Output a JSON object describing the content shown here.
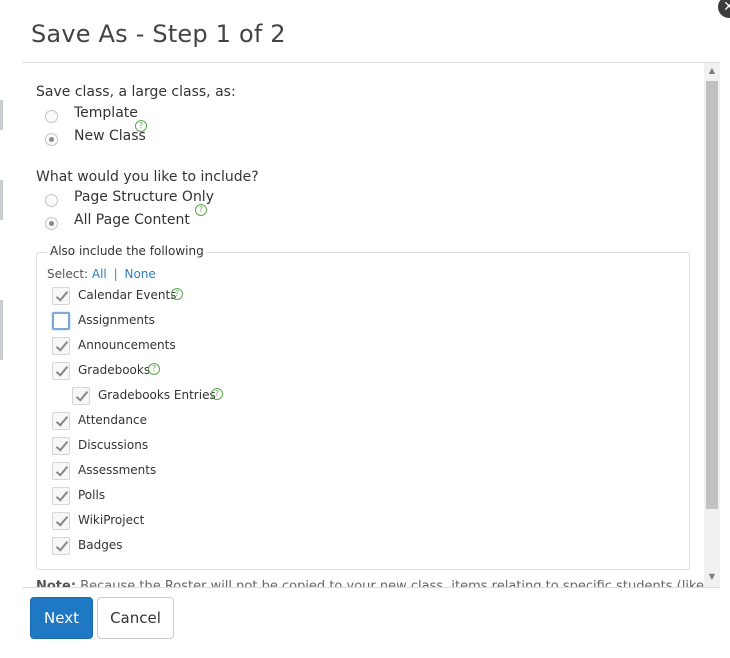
{
  "dialog": {
    "title": "Save As - Step 1 of 2",
    "close_icon": "close-icon"
  },
  "save_as": {
    "label": "Save class, a large class, as:",
    "options": [
      {
        "label": "Template",
        "checked": false
      },
      {
        "label": "New Class",
        "checked": true,
        "help": true
      }
    ]
  },
  "include": {
    "label": "What would you like to include?",
    "options": [
      {
        "label": "Page Structure Only",
        "checked": false
      },
      {
        "label": "All Page Content",
        "checked": true,
        "help": true
      }
    ]
  },
  "also_include": {
    "legend": "Also include the following",
    "select_prefix": "Select:",
    "select_all": "All",
    "select_separator": "|",
    "select_none": "None",
    "items": [
      {
        "label": "Calendar Events",
        "checked": true,
        "help": true
      },
      {
        "label": "Assignments",
        "checked": false,
        "focused": true
      },
      {
        "label": "Announcements",
        "checked": true
      },
      {
        "label": "Gradebooks",
        "checked": true,
        "help": true
      },
      {
        "label": "Gradebooks Entries",
        "checked": true,
        "help": true,
        "indented": true
      },
      {
        "label": "Attendance",
        "checked": true
      },
      {
        "label": "Discussions",
        "checked": true
      },
      {
        "label": "Assessments",
        "checked": true
      },
      {
        "label": "Polls",
        "checked": true
      },
      {
        "label": "WikiProject",
        "checked": true
      },
      {
        "label": "Badges",
        "checked": true
      }
    ]
  },
  "note": {
    "bold": "Note:",
    "text": " Because the Roster will not be copied to your new class, items relating to specific students (like"
  },
  "footer": {
    "next_label": "Next",
    "cancel_label": "Cancel"
  },
  "colors": {
    "primary": "#1f78c3",
    "link": "#2a7fc1",
    "help": "#5aa84a"
  }
}
